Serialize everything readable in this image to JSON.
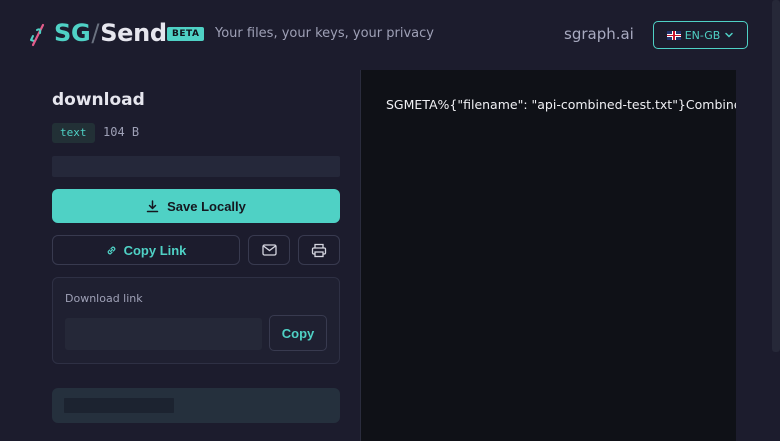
{
  "header": {
    "brand_sg": "SG",
    "brand_slash": "/",
    "brand_send": "Send",
    "badge": "BETA",
    "tagline": "Your files, your keys, your privacy",
    "site": "sgraph.ai",
    "language": "EN-GB",
    "accent_color": "#4fd1c5"
  },
  "file": {
    "title": "download",
    "type": "text",
    "size": "104 B"
  },
  "actions": {
    "save_label": "Save Locally",
    "copy_link_label": "Copy Link",
    "email_icon": "mail-icon",
    "print_icon": "printer-icon"
  },
  "link_panel": {
    "label": "Download link",
    "input_value": "",
    "copy_label": "Copy"
  },
  "preview": {
    "content": "SGMETA%{\"filename\": \"api-combined-test.txt\"}Combined"
  }
}
